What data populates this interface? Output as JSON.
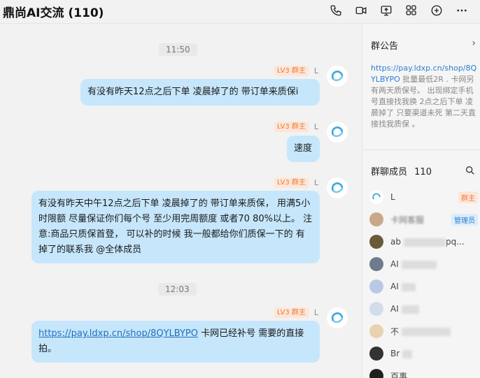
{
  "header": {
    "title": "鼎尚AI交流 (110)",
    "icons": [
      "phone-icon",
      "video-icon",
      "screen-share-icon",
      "apps-icon",
      "add-icon",
      "more-icon"
    ]
  },
  "chat": {
    "times": [
      "11:50",
      "12:03"
    ],
    "messages": [
      {
        "badge": "LV3 群主",
        "sender": "L",
        "text": "有没有昨天12点之后下单 凌晨掉了的 带订单来质保i"
      },
      {
        "badge": "LV3 群主",
        "sender": "L",
        "text": "速度"
      },
      {
        "badge": "LV3 群主",
        "sender": "L",
        "text": "有没有昨天中午12点之后下单 凌晨掉了的 带订单来质保， 用满5小时限额  尽量保证你们每个号 至少用完周额度 或者70 80%以上。  注意:商品只质保首登，  可以补的时候 我一般都给你们质保一下的  有掉了的联系我 @全体成员"
      },
      {
        "badge": "LV3 群主",
        "sender": "L",
        "link": "https://pay.ldxp.cn/shop/8QYLBYPO",
        "text": " 卡网已经补号 需要的直接拍。"
      }
    ]
  },
  "sidebar": {
    "notice_title": "群公告",
    "notice_link": "https://pay.ldxp.cn/shop/8QYLBYPO",
    "notice_text": " 批量最低2R . 卡网另有两天质保号。 出现绑定手机号直接找我换 2点之后下单 凌晨掉了 只要渠道未死 第二天直接找我质保 。",
    "members_title": "群聊成员",
    "members_count": "110",
    "members": [
      {
        "name": "L",
        "role": "群主"
      },
      {
        "name": "卡网客服",
        "role": "管理员"
      },
      {
        "name": "ab",
        "suffix": "pq...",
        "role": ""
      },
      {
        "name": "AI",
        "role": ""
      },
      {
        "name": "AI",
        "role": ""
      },
      {
        "name": "AI",
        "role": ""
      },
      {
        "name": "不",
        "role": ""
      },
      {
        "name": "Br",
        "role": ""
      },
      {
        "name": "百事",
        "role": ""
      }
    ]
  },
  "colors": {
    "bubble": "#c6e6fb",
    "owner_badge": "#f07a3a",
    "admin_badge": "#2a7fd0"
  }
}
